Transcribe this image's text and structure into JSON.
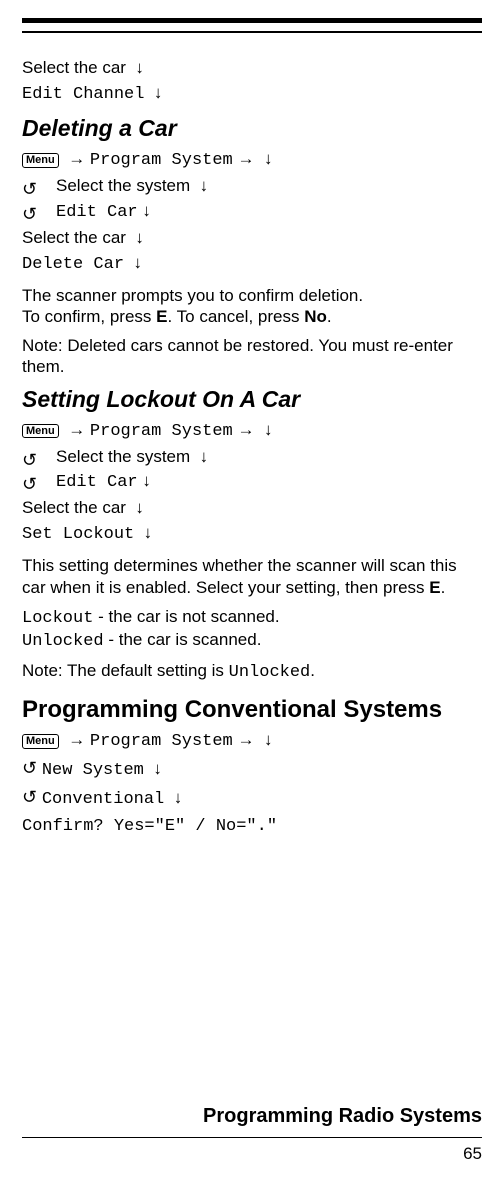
{
  "menu_label": "Menu",
  "arrows": {
    "right": "→",
    "down": "↓"
  },
  "rotate_icon": "↺",
  "top": {
    "line1_a": "Select the car",
    "line2_a": "Edit Channel"
  },
  "section1": {
    "heading": "Deleting a Car",
    "nav1": "Program System",
    "step1": "Select the system",
    "step2": "Edit Car",
    "step3": "Select the car",
    "step4": "Delete Car",
    "para1a": "The scanner prompts you to confirm deletion.",
    "para1b_pre": "To confirm, press ",
    "para1b_bold1": "E",
    "para1b_mid": ". To cancel, press ",
    "para1b_bold2": "No",
    "para1b_post": ".",
    "para2": "Note: Deleted cars cannot be restored. You must re-enter them."
  },
  "section2": {
    "heading": "Setting Lockout On A Car",
    "nav1": "Program System",
    "step1": "Select the system",
    "step2": "Edit Car",
    "step3": "Select the car",
    "step4": "Set Lockout",
    "para1_pre": "This setting determines whether the scanner will scan this car when it is enabled. Select your setting, then press ",
    "para1_bold": "E",
    "para1_post": ".",
    "opt1_code": "Lockout",
    "opt1_text": " - the car is not scanned.",
    "opt2_code": "Unlocked",
    "opt2_text": " - the car is scanned.",
    "note_pre": "Note: The default setting is ",
    "note_code": "Unlocked",
    "note_post": "."
  },
  "section3": {
    "heading": "Programming Conventional Systems",
    "nav1": "Program System",
    "step1": "New System",
    "step2": "Conventional",
    "confirm": "Confirm? Yes=\"E\" / No=\".\""
  },
  "footer": {
    "title": "Programming Radio Systems",
    "page": "65"
  }
}
